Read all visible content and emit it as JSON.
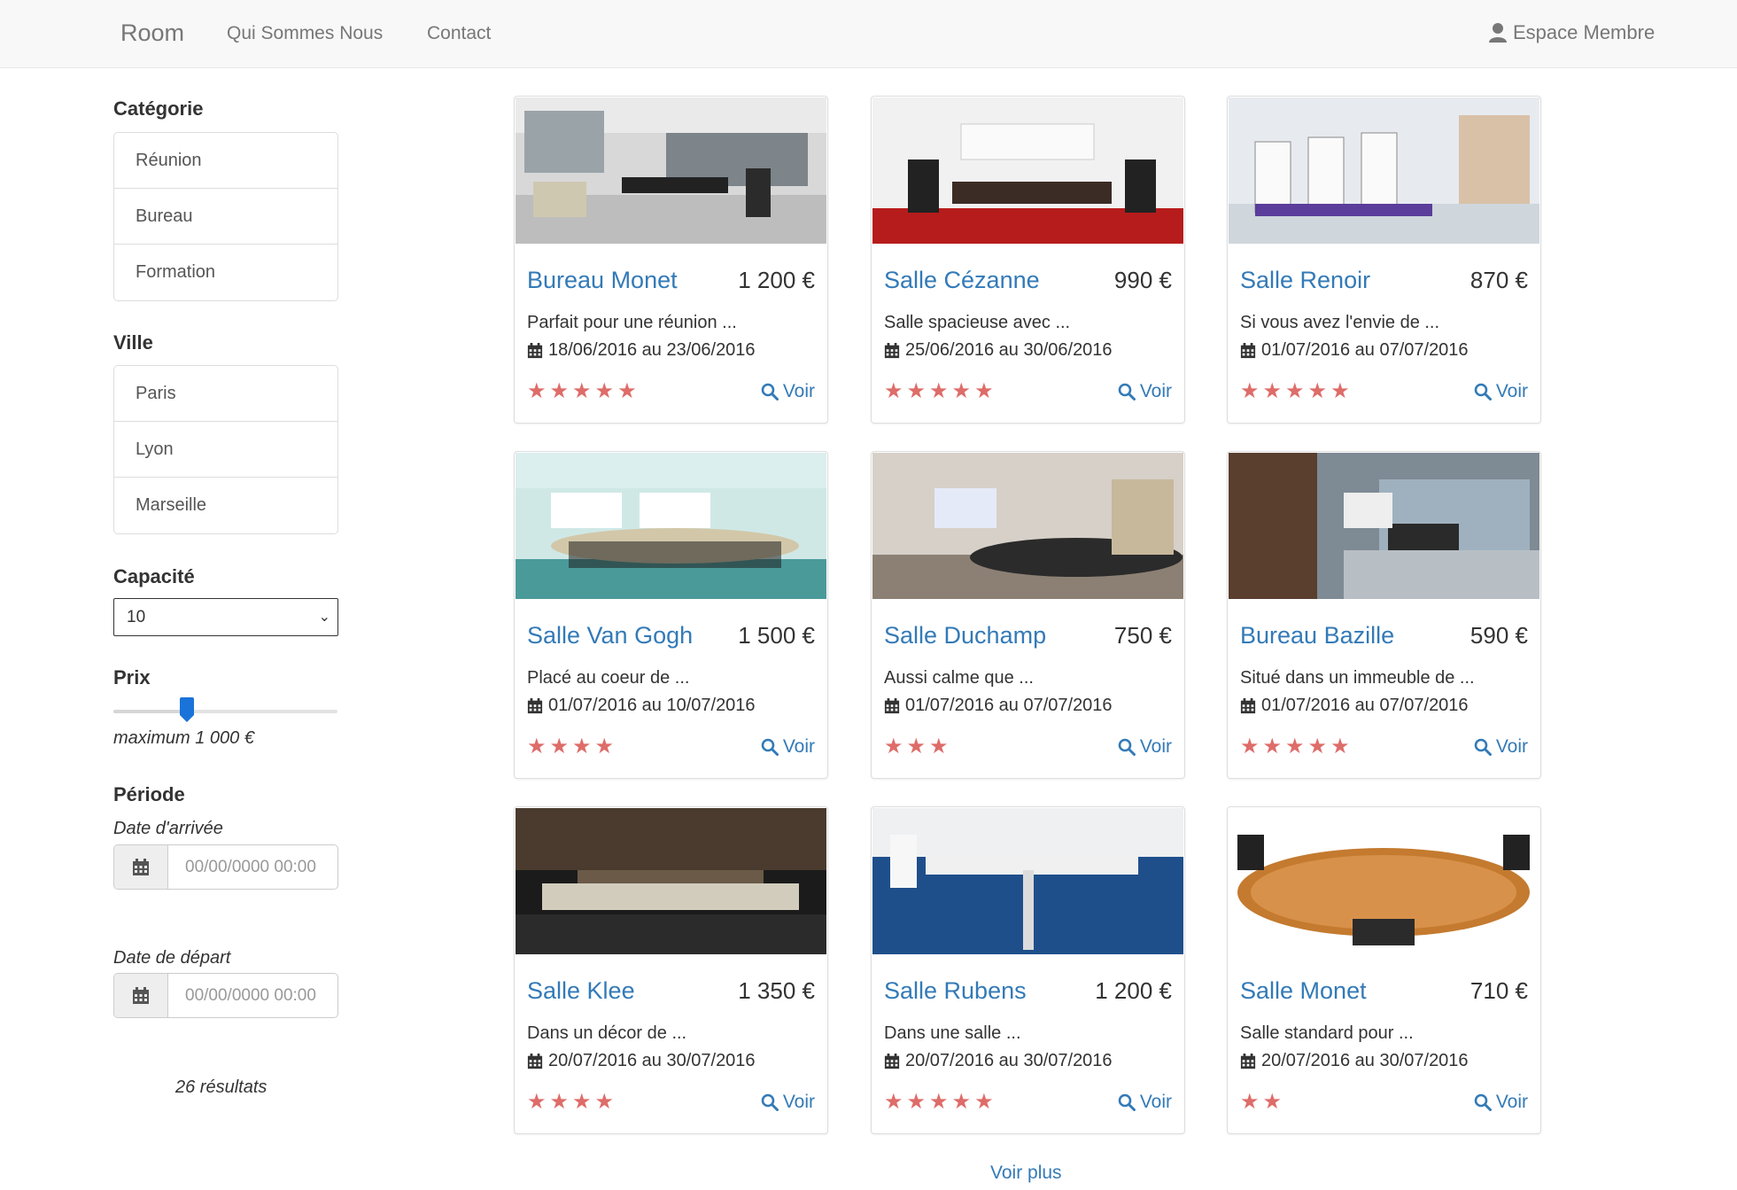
{
  "nav": {
    "brand": "Room",
    "links": [
      "Qui Sommes Nous",
      "Contact"
    ],
    "member": "Espace Membre"
  },
  "sidebar": {
    "category": {
      "title": "Catégorie",
      "items": [
        "Réunion",
        "Bureau",
        "Formation"
      ]
    },
    "city": {
      "title": "Ville",
      "items": [
        "Paris",
        "Lyon",
        "Marseille"
      ]
    },
    "capacity": {
      "title": "Capacité",
      "value": "10"
    },
    "price": {
      "title": "Prix",
      "max_label": "maximum 1 000 €",
      "slider_fraction": 0.33
    },
    "period": {
      "title": "Période",
      "arrival_label": "Date d'arrivée",
      "arrival_placeholder": "00/00/0000 00:00",
      "departure_label": "Date de départ",
      "departure_placeholder": "00/00/0000 00:00"
    },
    "results": "26 résultats"
  },
  "cards": [
    {
      "title": "Bureau Monet",
      "price": "1 200 €",
      "desc": "Parfait pour une réunion ...",
      "dates": "18/06/2016 au 23/06/2016",
      "stars": 5,
      "voir": "Voir"
    },
    {
      "title": "Salle Cézanne",
      "price": "990 €",
      "desc": "Salle spacieuse avec ...",
      "dates": "25/06/2016 au 30/06/2016",
      "stars": 5,
      "voir": "Voir"
    },
    {
      "title": "Salle Renoir",
      "price": "870 €",
      "desc": "Si vous avez l'envie de ...",
      "dates": "01/07/2016 au 07/07/2016",
      "stars": 5,
      "voir": "Voir"
    },
    {
      "title": "Salle Van Gogh",
      "price": "1 500 €",
      "desc": "Placé au coeur de ...",
      "dates": "01/07/2016 au 10/07/2016",
      "stars": 4,
      "voir": "Voir"
    },
    {
      "title": "Salle Duchamp",
      "price": "750 €",
      "desc": "Aussi calme que ...",
      "dates": "01/07/2016 au 07/07/2016",
      "stars": 3,
      "voir": "Voir"
    },
    {
      "title": "Bureau Bazille",
      "price": "590 €",
      "desc": "Situé dans un immeuble de ...",
      "dates": "01/07/2016 au 07/07/2016",
      "stars": 5,
      "voir": "Voir"
    },
    {
      "title": "Salle Klee",
      "price": "1 350 €",
      "desc": "Dans un décor de ...",
      "dates": "20/07/2016 au 30/07/2016",
      "stars": 4,
      "voir": "Voir"
    },
    {
      "title": "Salle Rubens",
      "price": "1 200 €",
      "desc": "Dans une salle ...",
      "dates": "20/07/2016 au 30/07/2016",
      "stars": 5,
      "voir": "Voir"
    },
    {
      "title": "Salle Monet",
      "price": "710 €",
      "desc": "Salle standard pour ...",
      "dates": "20/07/2016 au 30/07/2016",
      "stars": 2,
      "voir": "Voir"
    }
  ],
  "more": "Voir plus",
  "colors": {
    "link": "#337ab7",
    "star": "#d9534f",
    "slider_thumb": "#1a73d9"
  }
}
